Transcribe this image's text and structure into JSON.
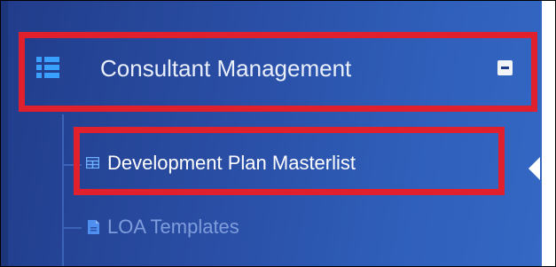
{
  "sidebar": {
    "group": {
      "label": "Consultant Management",
      "icon": "list-icon",
      "toggle_icon": "minus-square-icon",
      "expanded": true
    },
    "items": [
      {
        "label": "Development Plan Masterlist",
        "icon": "table-grid-icon",
        "active": true
      },
      {
        "label": "LOA Templates",
        "icon": "document-icon",
        "active": false
      }
    ]
  },
  "colors": {
    "sidebar_bg_dark": "#213c8a",
    "sidebar_bg_light": "#3468c4",
    "active_text": "#ffffff",
    "inactive_text": "#7f9ddd",
    "highlight": "#e0202c"
  }
}
